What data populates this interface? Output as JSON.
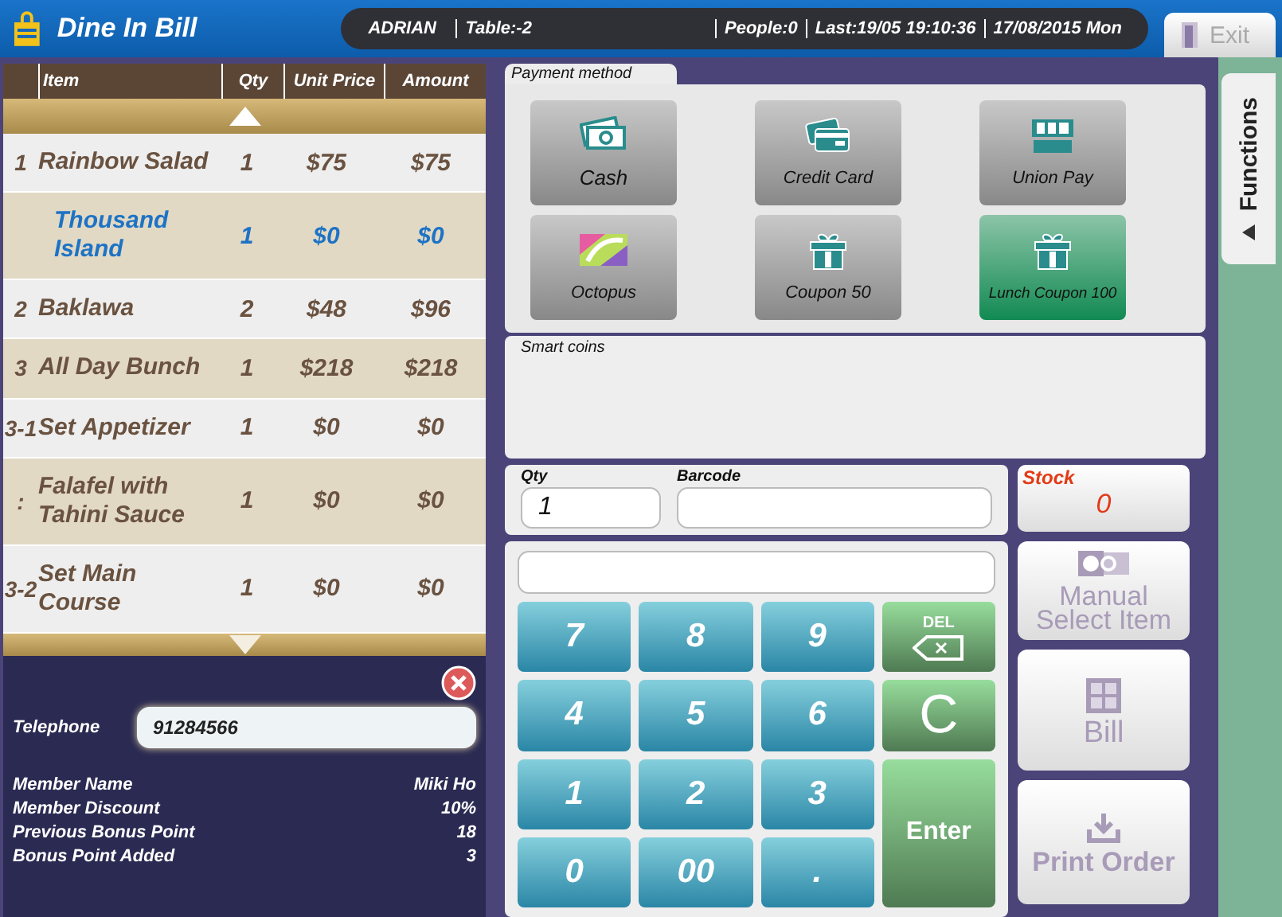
{
  "header": {
    "title": "Dine In Bill",
    "info": [
      "ADRIAN",
      "Table:-2",
      "People:0",
      "Last:19/05 19:10:36",
      "17/08/2015 Mon"
    ],
    "exit": "Exit"
  },
  "order": {
    "columns": [
      "Item",
      "Qty",
      "Unit Price",
      "Amount"
    ],
    "rows": [
      {
        "kind": "item",
        "no": "1",
        "item": "Rainbow Salad",
        "qty": "1",
        "unit_price": "$75",
        "amount": "$75"
      },
      {
        "kind": "modifier",
        "item": "Thousand Island",
        "qty": "1",
        "unit_price": "$0",
        "amount": "$0"
      },
      {
        "kind": "item",
        "no": "2",
        "item": "Baklawa",
        "qty": "2",
        "unit_price": "$48",
        "amount": "$96"
      },
      {
        "kind": "item",
        "no": "3",
        "item": "All Day Bunch",
        "qty": "1",
        "unit_price": "$218",
        "amount": "$218"
      },
      {
        "kind": "item",
        "no": "3-1",
        "item": "Set Appetizer",
        "qty": "1",
        "unit_price": "$0",
        "amount": "$0"
      },
      {
        "kind": "item",
        "no": ":",
        "item": "Falafel with Tahini Sauce",
        "qty": "1",
        "unit_price": "$0",
        "amount": "$0"
      },
      {
        "kind": "item",
        "no": "3-2",
        "item": "Set Main Course",
        "qty": "1",
        "unit_price": "$0",
        "amount": "$0"
      }
    ]
  },
  "member": {
    "telephone_label": "Telephone",
    "telephone": "91284566",
    "details": [
      {
        "label": "Member Name",
        "value": "Miki Ho"
      },
      {
        "label": "Member Discount",
        "value": "10%"
      },
      {
        "label": "Previous Bonus Point",
        "value": "18"
      },
      {
        "label": "Bonus Point Added",
        "value": "3"
      }
    ]
  },
  "payment": {
    "title": "Payment method",
    "methods": [
      {
        "label": "Cash",
        "kind": "cash",
        "selected": false
      },
      {
        "label": "Credit Card",
        "kind": "card",
        "selected": false
      },
      {
        "label": "Union Pay",
        "kind": "eps",
        "selected": false
      },
      {
        "label": "Octopus",
        "kind": "octopus",
        "selected": false
      },
      {
        "label": "Coupon 50",
        "kind": "gift",
        "selected": false
      },
      {
        "label": "Lunch Coupon 100",
        "kind": "gift",
        "selected": true
      }
    ]
  },
  "smart_coins": {
    "title": "Smart coins"
  },
  "entry": {
    "qty_label": "Qty",
    "qty": "1",
    "barcode_label": "Barcode"
  },
  "stock": {
    "label": "Stock",
    "value": "0"
  },
  "keypad": [
    {
      "kind": "digit",
      "label": "7"
    },
    {
      "kind": "digit",
      "label": "8"
    },
    {
      "kind": "digit",
      "label": "9"
    },
    {
      "kind": "del",
      "label": "DEL"
    },
    {
      "kind": "digit",
      "label": "4"
    },
    {
      "kind": "digit",
      "label": "5"
    },
    {
      "kind": "digit",
      "label": "6"
    },
    {
      "kind": "clear",
      "label": "C"
    },
    {
      "kind": "digit",
      "label": "1"
    },
    {
      "kind": "digit",
      "label": "2"
    },
    {
      "kind": "digit",
      "label": "3"
    },
    {
      "kind": "enter",
      "label": "Enter"
    },
    {
      "kind": "digit",
      "label": "0"
    },
    {
      "kind": "digit",
      "label": "00"
    },
    {
      "kind": "digit",
      "label": "."
    }
  ],
  "side_buttons": [
    {
      "kind": "manual",
      "label": "Manual Select Item"
    },
    {
      "kind": "bill",
      "label": "Bill"
    },
    {
      "kind": "print",
      "label": "Print Order"
    }
  ],
  "functions_tab": {
    "label": "Functions"
  }
}
